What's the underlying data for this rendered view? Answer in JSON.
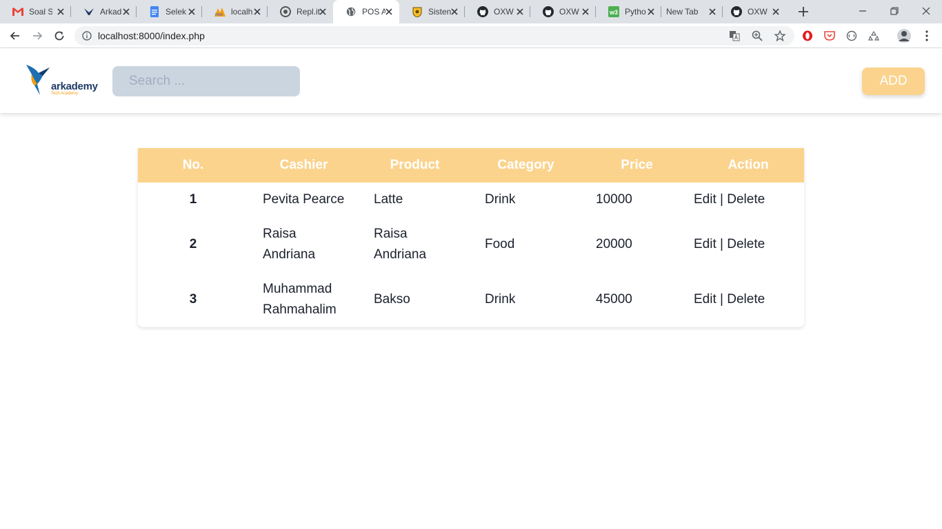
{
  "browser": {
    "tabs": [
      {
        "title": "Soal S",
        "icon": "gmail-icon"
      },
      {
        "title": "Arkad",
        "icon": "arkademy-icon"
      },
      {
        "title": "Selek",
        "icon": "docs-icon"
      },
      {
        "title": "localh",
        "icon": "phpmyadmin-icon"
      },
      {
        "title": "Repl.it",
        "icon": "replit-icon"
      },
      {
        "title": "POS A",
        "icon": "globe-icon"
      },
      {
        "title": "Sisten",
        "icon": "university-icon"
      },
      {
        "title": "OXW",
        "icon": "github-icon"
      },
      {
        "title": "OXW",
        "icon": "github-icon"
      },
      {
        "title": "Pytho",
        "icon": "w3schools-icon"
      },
      {
        "title": "New Tab",
        "icon": ""
      },
      {
        "title": "OXW",
        "icon": "github-icon"
      }
    ],
    "url": "localhost:8000/index.php"
  },
  "header": {
    "logo_text": "arkademy",
    "logo_tagline": "Tech Academy",
    "search_placeholder": "Search ...",
    "add_label": "ADD"
  },
  "table": {
    "columns": [
      "No.",
      "Cashier",
      "Product",
      "Category",
      "Price",
      "Action"
    ],
    "rows": [
      {
        "no": "1",
        "cashier": "Pevita Pearce",
        "product": "Latte",
        "category": "Drink",
        "price": "10000",
        "edit": "Edit",
        "sep": "|",
        "delete": "Delete"
      },
      {
        "no": "2",
        "cashier": "Raisa Andriana",
        "product": "Raisa Andriana",
        "category": "Food",
        "price": "20000",
        "edit": "Edit",
        "sep": "|",
        "delete": "Delete"
      },
      {
        "no": "3",
        "cashier": "Muhammad Rahmahalim",
        "product": "Bakso",
        "category": "Drink",
        "price": "45000",
        "edit": "Edit",
        "sep": "|",
        "delete": "Delete"
      }
    ]
  },
  "colors": {
    "accent": "#fbd38d",
    "search_bg": "#cbd5e0"
  }
}
